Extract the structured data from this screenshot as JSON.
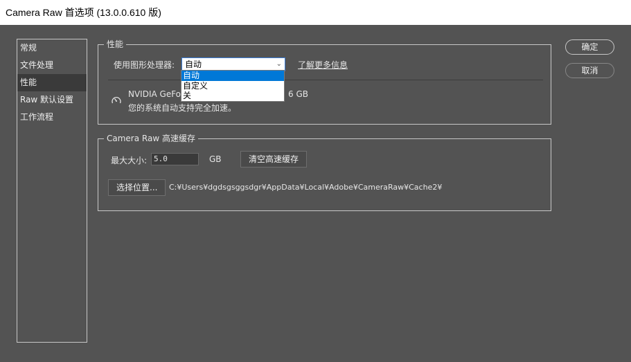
{
  "window": {
    "title": "Camera Raw 首选项  (13.0.0.610 版)"
  },
  "sidebar": {
    "items": [
      {
        "label": "常规"
      },
      {
        "label": "文件处理"
      },
      {
        "label": "性能"
      },
      {
        "label": "Raw 默认设置"
      },
      {
        "label": "工作流程"
      }
    ],
    "active_index": 2
  },
  "performance": {
    "legend": "性能",
    "gpu_label": "使用图形处理器:",
    "gpu_selected": "自动",
    "learn_more": "了解更多信息",
    "gpu_options": [
      "自动",
      "自定义",
      "关"
    ],
    "gpu_name_visible": "NVIDIA GeForc",
    "gpu_memory_visible": "6 GB",
    "accel_status": "您的系统自动支持完全加速。"
  },
  "cache": {
    "legend": "Camera Raw 高速缓存",
    "max_size_label": "最大大小:",
    "max_size_value": "5.0",
    "unit": "GB",
    "purge_button": "清空高速缓存",
    "choose_location_button": "选择位置...",
    "path": "C:¥Users¥dgdsgsggsdgr¥AppData¥Local¥Adobe¥CameraRaw¥Cache2¥"
  },
  "buttons": {
    "ok": "确定",
    "cancel": "取消"
  },
  "icons": {
    "gauge": "gauge-icon",
    "chevron": "chevron-down-icon"
  },
  "colors": {
    "background": "#535353",
    "highlight": "#0078d7",
    "border": "#c8c8c8"
  }
}
